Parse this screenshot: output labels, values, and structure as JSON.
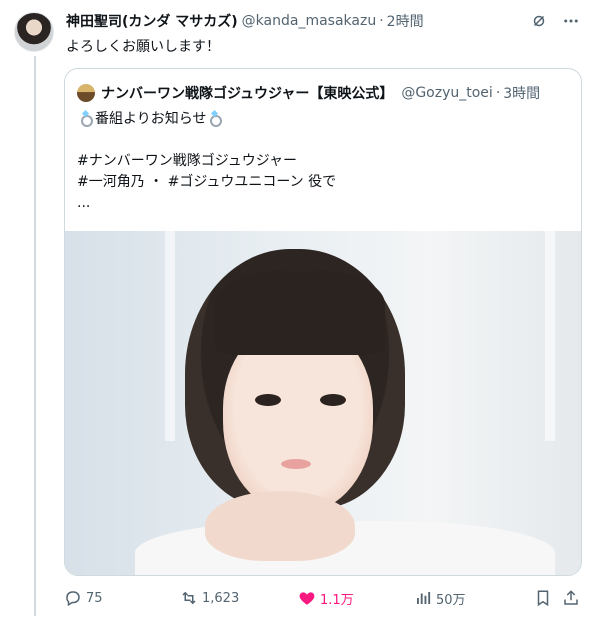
{
  "tweet": {
    "author": {
      "display_name": "神田聖司(カンダ マサカズ)",
      "handle": "@kanda_masakazu",
      "separator": "·",
      "time": "2時間"
    },
    "text": "よろしくお願いします！",
    "top_icons": [
      "grok-icon",
      "more-icon"
    ]
  },
  "quote": {
    "display_name": "ナンバーワン戦隊ゴジュウジャー【東映公式】",
    "handle": "@Gozyu_toei",
    "separator": "·",
    "time": "3時間",
    "lines": [
      "番組よりお知らせ",
      "",
      "#ナンバーワン戦隊ゴジュウジャー",
      "#一河角乃 ・ #ゴジュウユニコーン 役で",
      "..."
    ]
  },
  "actions": {
    "reply_count": "75",
    "retweet_count": "1,623",
    "like_count": "1.1万",
    "view_count": "50万"
  },
  "colors": {
    "like_pink": "#f91880",
    "muted_gray": "#536471",
    "border": "#cfd9de"
  }
}
